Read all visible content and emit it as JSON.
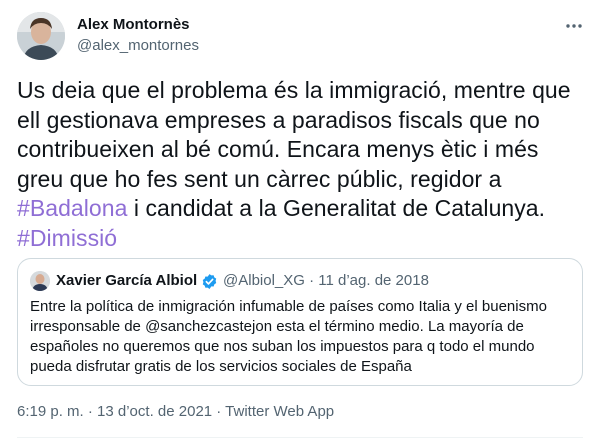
{
  "author": {
    "name": "Alex Montornès",
    "handle": "@alex_montornes"
  },
  "icons": {
    "more": "more-horizontal-icon",
    "verified": "verified-badge-icon"
  },
  "colors": {
    "hashtag": "#8f6ed5",
    "secondary_text": "#536471",
    "verified": "#1d9bf0",
    "border": "#cfd9de"
  },
  "tweet": {
    "text_1": "Us deia que el problema és la immigració, mentre que ell gestionava empreses a paradisos fiscals que no contribueixen al bé comú. Encara menys ètic i més greu que ho fes sent un càrrec públic, regidor a ",
    "hashtag_1": "#Badalona",
    "text_2": " i candidat a la Generalitat de Catalunya. ",
    "hashtag_2": "#Dimissió"
  },
  "quote": {
    "name": "Xavier García Albiol",
    "meta": "@Albiol_XG · 11 d’ag. de 2018",
    "text": "Entre la política de inmigración infumable de países como Italia y el buenismo irresponsable de @sanchezcastejon esta el término medio. La mayoría de españoles no queremos que nos suban los impuestos para q todo el mundo pueda disfrutar gratis de los  servicios sociales de España"
  },
  "footer": {
    "timestamp": "6:19 p. m. · 13 d’oct. de 2021 · Twitter Web App"
  }
}
